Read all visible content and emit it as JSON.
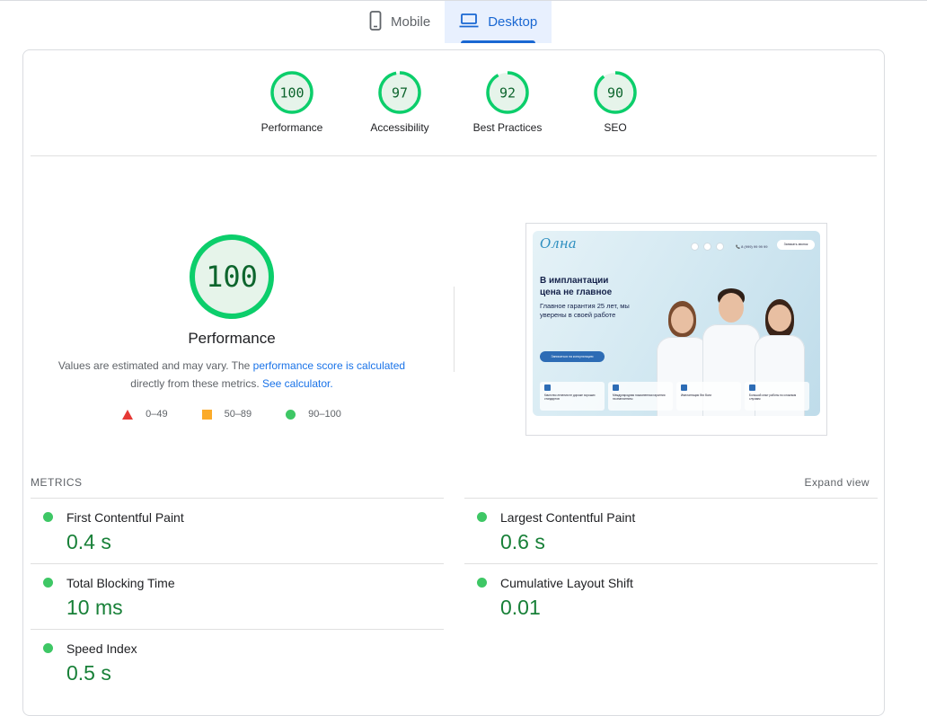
{
  "tabs": [
    {
      "label": "Mobile",
      "icon": "phone-icon",
      "active": false
    },
    {
      "label": "Desktop",
      "icon": "laptop-icon",
      "active": true
    }
  ],
  "gauges": [
    {
      "label": "Performance",
      "score": 100
    },
    {
      "label": "Accessibility",
      "score": 97
    },
    {
      "label": "Best Practices",
      "score": 92
    },
    {
      "label": "SEO",
      "score": 90
    }
  ],
  "main_gauge": {
    "score": 100,
    "title": "Performance",
    "desc_prefix": "Values are estimated and may vary. The ",
    "desc_link1": "performance score is calculated",
    "desc_mid": " directly from these metrics. ",
    "desc_link2": "See calculator."
  },
  "legend": [
    {
      "range": "0–49",
      "shape": "triangle",
      "color": "#e53935"
    },
    {
      "range": "50–89",
      "shape": "square",
      "color": "#fbab2a"
    },
    {
      "range": "90–100",
      "shape": "circle",
      "color": "#3ec765"
    }
  ],
  "screenshot": {
    "logo": "Олна",
    "phone": "📞 8 (999) 99 99 99",
    "header_button": "Записать звонок",
    "heading": "В имплантации цена не главное",
    "subheading": "Главное гарантия 25 лет, мы уверены в своей работе",
    "cta": "Записаться на консультацию",
    "features": [
      "Качество лечения не дороже хороших стандартов",
      "Международная пожизненная гарантия на имплантаты",
      "Имплантация без боли",
      "Большой опыт работы по сложным случаям"
    ]
  },
  "metrics": {
    "header": "METRICS",
    "expand": "Expand view",
    "left": [
      {
        "name": "First Contentful Paint",
        "value": "0.4 s"
      },
      {
        "name": "Total Blocking Time",
        "value": "10 ms"
      },
      {
        "name": "Speed Index",
        "value": "0.5 s"
      }
    ],
    "right": [
      {
        "name": "Largest Contentful Paint",
        "value": "0.6 s"
      },
      {
        "name": "Cumulative Layout Shift",
        "value": "0.01"
      }
    ]
  },
  "colors": {
    "pass": "#0cce6b",
    "pass_bg": "#e6f4ea",
    "accent": "#1967d2"
  }
}
